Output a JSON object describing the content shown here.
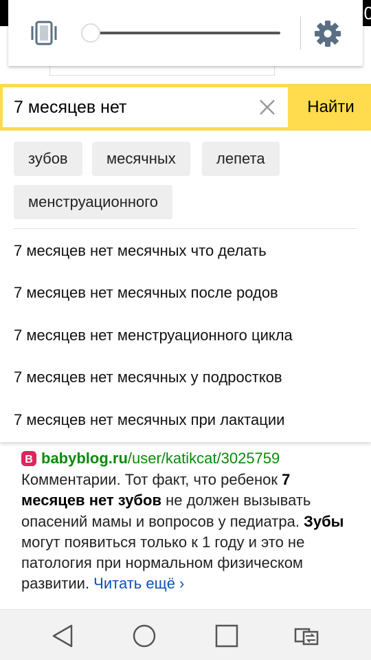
{
  "status_bar": {
    "clock_fragment": "0"
  },
  "quick_settings": {
    "sound_mode_icon": "vibrate-icon",
    "brightness_level": 0,
    "settings_icon": "gear-icon"
  },
  "search": {
    "query": "7 месяцев нет",
    "clear_icon": "close-icon",
    "button_label": "Найти",
    "accent_color": "#ffdb4d"
  },
  "suggestions": {
    "chips": [
      "зубов",
      "месячных",
      "лепета",
      "менструационного"
    ],
    "items": [
      "7 месяцев нет месячных что делать",
      "7 месяцев нет месячных после родов",
      "7 месяцев нет менструационного цикла",
      "7 месяцев нет месячных у подростков",
      "7 месяцев нет месячных при лактации"
    ]
  },
  "result": {
    "favicon": "babyblog-icon",
    "domain": "babyblog.ru",
    "path": "/user/katikcat/3025759",
    "text_1": "Комментарии. Тот факт, что ребенок ",
    "bold_1": "7 месяцев нет зубов",
    "text_2": " не должен вызывать опасений мамы и вопросов у педиатра. ",
    "bold_2": "Зубы",
    "text_3": " могут появиться только к 1 году и это не патология при нормальном физическом развитии. ",
    "read_more": "Читать ещё ›",
    "link_color": "#0a8a0a"
  },
  "nav_bar": {
    "icons": [
      "back-icon",
      "home-icon",
      "recents-icon",
      "switch-app-icon"
    ]
  }
}
